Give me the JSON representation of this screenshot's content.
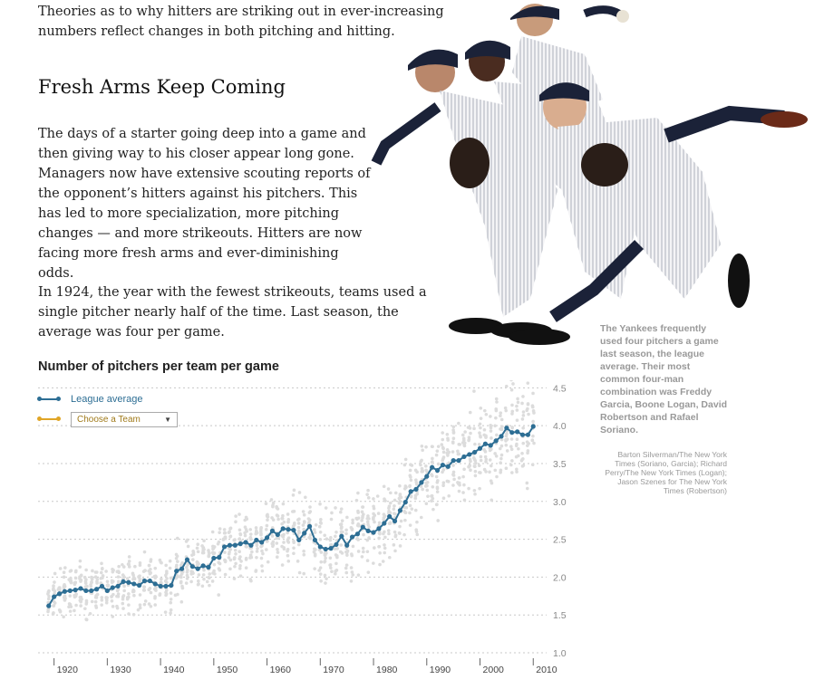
{
  "article": {
    "intro": "Theories as to why hitters are striking out in ever-increasing numbers reflect changes in both pitching and hitting.",
    "section_title": "Fresh Arms Keep Coming",
    "paragraph1": "The days of a starter going deep into a game and then giving way to his closer appear long gone. Managers now have extensive scouting reports of the opponent’s hitters against his pitchers. This has led to more specialization, more pitching changes — and more strikeouts. Hitters are now facing more fresh arms and ever-diminishing odds.",
    "paragraph2": "In 1924, the year with the fewest strikeouts, teams used a single pitcher nearly half of the time. Last season, the average was four per game."
  },
  "photo": {
    "caption": "The Yankees frequently used four pitchers a game last season, the league average. Their most common four-man combination was Freddy Garcia, Boone Logan, David Robertson and Rafael Soriano.",
    "credit": "Barton Silverman/The New York Times (Soriano, Garcia); Richard Perry/The New York Times (Logan); Jason Szenes for The New York Times (Robertson)"
  },
  "legend": {
    "league_label": "League average",
    "team_select_value": "Choose a Team",
    "league_color": "#2d6e94",
    "team_color": "#e0a526"
  },
  "chart_data": {
    "type": "scatter",
    "title": "Number of pitchers per team per game",
    "xlabel": "",
    "ylabel": "",
    "xlim": [
      1917,
      2012
    ],
    "ylim": [
      1.0,
      4.6
    ],
    "yticks": [
      1.0,
      1.5,
      2.0,
      2.5,
      3.0,
      3.5,
      4.0,
      4.5
    ],
    "ytick_labels": [
      "1.0",
      "1.5",
      "2.0",
      "2.5",
      "3.0",
      "3.5",
      "4.0",
      "4.5"
    ],
    "xticks": [
      1920,
      1930,
      1940,
      1950,
      1960,
      1970,
      1980,
      1990,
      2000,
      2010
    ],
    "xtick_labels": [
      "1920",
      "1930",
      "1940",
      "1950",
      "1960",
      "1970",
      "1980",
      "1990",
      "2000",
      "2010"
    ],
    "grid": true,
    "legend_position": "top-left",
    "series": [
      {
        "name": "League average",
        "color": "#2d6e94",
        "x": [
          1919,
          1920,
          1921,
          1922,
          1923,
          1924,
          1925,
          1926,
          1927,
          1928,
          1929,
          1930,
          1931,
          1932,
          1933,
          1934,
          1935,
          1936,
          1937,
          1938,
          1939,
          1940,
          1941,
          1942,
          1943,
          1944,
          1945,
          1946,
          1947,
          1948,
          1949,
          1950,
          1951,
          1952,
          1953,
          1954,
          1955,
          1956,
          1957,
          1958,
          1959,
          1960,
          1961,
          1962,
          1963,
          1964,
          1965,
          1966,
          1967,
          1968,
          1969,
          1970,
          1971,
          1972,
          1973,
          1974,
          1975,
          1976,
          1977,
          1978,
          1979,
          1980,
          1981,
          1982,
          1983,
          1984,
          1985,
          1986,
          1987,
          1988,
          1989,
          1990,
          1991,
          1992,
          1993,
          1994,
          1995,
          1996,
          1997,
          1998,
          1999,
          2000,
          2001,
          2002,
          2003,
          2004,
          2005,
          2006,
          2007,
          2008,
          2009,
          2010
        ],
        "values": [
          1.62,
          1.74,
          1.78,
          1.81,
          1.82,
          1.83,
          1.85,
          1.82,
          1.82,
          1.84,
          1.88,
          1.82,
          1.86,
          1.88,
          1.94,
          1.93,
          1.91,
          1.89,
          1.95,
          1.95,
          1.91,
          1.88,
          1.88,
          1.89,
          2.08,
          2.11,
          2.23,
          2.14,
          2.11,
          2.15,
          2.13,
          2.25,
          2.26,
          2.4,
          2.42,
          2.42,
          2.44,
          2.46,
          2.42,
          2.49,
          2.46,
          2.52,
          2.61,
          2.56,
          2.64,
          2.63,
          2.62,
          2.49,
          2.58,
          2.67,
          2.49,
          2.4,
          2.37,
          2.38,
          2.43,
          2.54,
          2.42,
          2.53,
          2.57,
          2.66,
          2.61,
          2.59,
          2.64,
          2.71,
          2.8,
          2.74,
          2.88,
          2.99,
          3.13,
          3.16,
          3.25,
          3.33,
          3.45,
          3.41,
          3.48,
          3.46,
          3.54,
          3.54,
          3.59,
          3.62,
          3.65,
          3.7,
          3.76,
          3.74,
          3.8,
          3.86,
          3.97,
          3.91,
          3.92,
          3.88,
          3.88,
          3.99
        ]
      }
    ]
  }
}
